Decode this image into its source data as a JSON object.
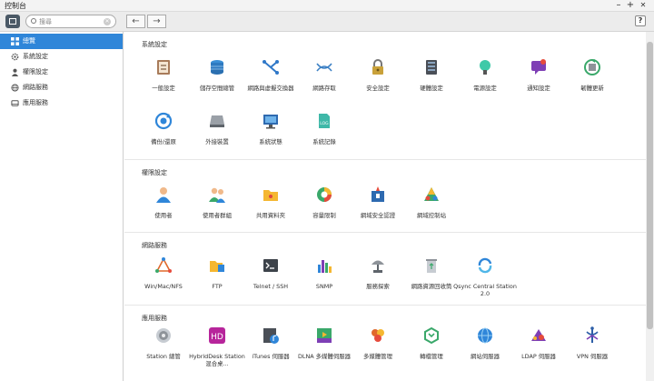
{
  "window": {
    "title": "控制台",
    "minimize": "–",
    "maximize": "+",
    "close": "✕"
  },
  "toolbar": {
    "search_placeholder": "搜尋",
    "back": "←",
    "forward": "→",
    "help": "?"
  },
  "sidebar": {
    "items": [
      {
        "label": "總覽",
        "icon": "grid-icon"
      },
      {
        "label": "系統設定",
        "icon": "gear-icon"
      },
      {
        "label": "權限設定",
        "icon": "user-icon"
      },
      {
        "label": "網路服務",
        "icon": "globe-icon"
      },
      {
        "label": "應用服務",
        "icon": "drive-icon"
      }
    ]
  },
  "sections": [
    {
      "title": "系統設定",
      "items": [
        {
          "label": "一般設定",
          "icon": "general-settings-icon"
        },
        {
          "label": "儲存空間總管",
          "icon": "storage-manager-icon"
        },
        {
          "label": "網路與虛擬交換器",
          "icon": "network-switch-icon"
        },
        {
          "label": "網路存取",
          "icon": "network-access-icon"
        },
        {
          "label": "安全設定",
          "icon": "lock-icon"
        },
        {
          "label": "硬體設定",
          "icon": "hardware-icon"
        },
        {
          "label": "電源設定",
          "icon": "power-bulb-icon"
        },
        {
          "label": "通知設定",
          "icon": "notification-icon"
        },
        {
          "label": "韌體更新",
          "icon": "firmware-icon"
        },
        {
          "label": "備份/還原",
          "icon": "backup-restore-icon"
        },
        {
          "label": "外接裝置",
          "icon": "external-device-icon"
        },
        {
          "label": "系統狀態",
          "icon": "system-status-icon"
        },
        {
          "label": "系統記錄",
          "icon": "system-log-icon"
        }
      ]
    },
    {
      "title": "權限設定",
      "items": [
        {
          "label": "使用者",
          "icon": "user-icon"
        },
        {
          "label": "使用者群組",
          "icon": "user-group-icon"
        },
        {
          "label": "共用資料夾",
          "icon": "shared-folder-icon"
        },
        {
          "label": "容量限制",
          "icon": "quota-icon"
        },
        {
          "label": "網域安全認證",
          "icon": "domain-security-icon"
        },
        {
          "label": "網域控制站",
          "icon": "domain-controller-icon"
        }
      ]
    },
    {
      "title": "網路服務",
      "items": [
        {
          "label": "Win/Mac/NFS",
          "icon": "win-mac-nfs-icon"
        },
        {
          "label": "FTP",
          "icon": "ftp-icon"
        },
        {
          "label": "Telnet / SSH",
          "icon": "terminal-icon"
        },
        {
          "label": "SNMP",
          "icon": "snmp-icon"
        },
        {
          "label": "服務探索",
          "icon": "service-discovery-icon"
        },
        {
          "label": "網路資源回收筒",
          "icon": "recycle-bin-icon"
        },
        {
          "label": "Qsync Central Station 2.0",
          "icon": "qsync-icon"
        }
      ]
    },
    {
      "title": "應用服務",
      "items": [
        {
          "label": "Station 總管",
          "icon": "station-manager-icon"
        },
        {
          "label": "HybridDesk Station 混合桌...",
          "icon": "hybriddesk-icon"
        },
        {
          "label": "iTunes 伺服器",
          "icon": "itunes-server-icon"
        },
        {
          "label": "DLNA 多媒體伺服器",
          "icon": "dlna-icon"
        },
        {
          "label": "多媒體管理",
          "icon": "multimedia-icon"
        },
        {
          "label": "轉檔管理",
          "icon": "transcode-icon"
        },
        {
          "label": "網站伺服器",
          "icon": "web-server-icon"
        },
        {
          "label": "LDAP 伺服器",
          "icon": "ldap-icon"
        },
        {
          "label": "VPN 伺服器",
          "icon": "vpn-icon"
        }
      ]
    }
  ]
}
